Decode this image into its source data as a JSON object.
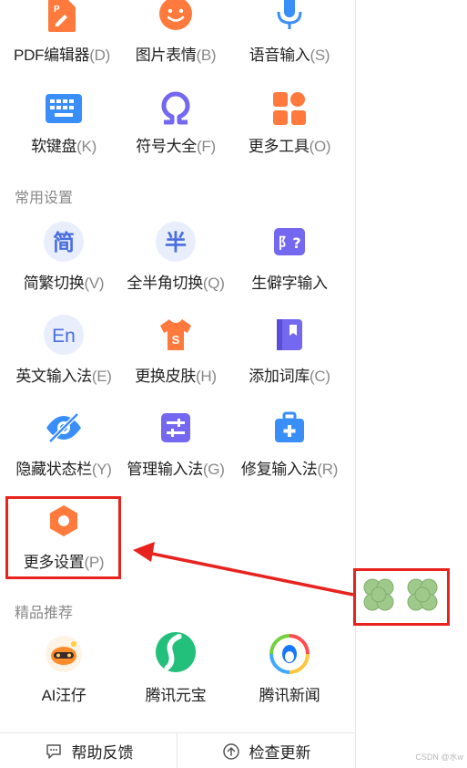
{
  "rows": [
    [
      {
        "name": "pdf-editor-item",
        "icon": "pdf-icon",
        "text": "PDF编辑器",
        "key": "(D)"
      },
      {
        "name": "emoji-item",
        "icon": "smiley-icon",
        "text": "图片表情",
        "key": "(B)"
      },
      {
        "name": "voice-input-item",
        "icon": "microphone-icon",
        "text": "语音输入",
        "key": "(S)"
      }
    ],
    [
      {
        "name": "soft-keyboard-item",
        "icon": "keyboard-icon",
        "text": "软键盘",
        "key": "(K)"
      },
      {
        "name": "symbols-item",
        "icon": "omega-icon",
        "text": "符号大全",
        "key": "(F)"
      },
      {
        "name": "more-tools-item",
        "icon": "grid-icon",
        "text": "更多工具",
        "key": "(O)"
      }
    ]
  ],
  "section_common": "常用设置",
  "settings_rows": [
    [
      {
        "name": "simplified-traditional-item",
        "icon": "jian-icon",
        "glyph": "简",
        "text": "简繁切换",
        "key": "(V)"
      },
      {
        "name": "full-half-width-item",
        "icon": "ban-icon",
        "glyph": "半",
        "text": "全半角切换",
        "key": "(Q)"
      },
      {
        "name": "rare-char-input-item",
        "icon": "rare-char-icon",
        "glyph": "阝?",
        "text": "生僻字输入",
        "key": ""
      }
    ],
    [
      {
        "name": "english-input-item",
        "icon": "en-icon",
        "glyph": "En",
        "text": "英文输入法",
        "key": "(E)"
      },
      {
        "name": "change-skin-item",
        "icon": "tshirt-icon",
        "glyph": "S",
        "text": "更换皮肤",
        "key": "(H)"
      },
      {
        "name": "add-dictionary-item",
        "icon": "book-icon",
        "glyph": "",
        "text": "添加词库",
        "key": "(C)"
      }
    ],
    [
      {
        "name": "hide-statusbar-item",
        "icon": "eye-off-icon",
        "glyph": "",
        "text": "隐藏状态栏",
        "key": "(Y)"
      },
      {
        "name": "manage-ime-item",
        "icon": "sliders-icon",
        "glyph": "",
        "text": "管理输入法",
        "key": "(G)"
      },
      {
        "name": "repair-ime-item",
        "icon": "toolbox-icon",
        "glyph": "",
        "text": "修复输入法",
        "key": "(R)"
      }
    ],
    [
      {
        "name": "more-settings-item",
        "icon": "hexagon-settings-icon",
        "glyph": "",
        "text": "更多设置",
        "key": "(P)"
      }
    ]
  ],
  "section_featured": "精品推荐",
  "featured": [
    {
      "name": "ai-wangzai-item",
      "icon": "ai-wangzai-icon",
      "text": "AI汪仔"
    },
    {
      "name": "tencent-yuanbao-item",
      "icon": "yuanbao-icon",
      "text": "腾讯元宝"
    },
    {
      "name": "tencent-news-item",
      "icon": "news-icon",
      "text": "腾讯新闻"
    }
  ],
  "footer": {
    "help": "帮助反馈",
    "update": "检查更新"
  },
  "watermark": "CSDN @水w",
  "colors": {
    "accent_orange": "#ff7a3c",
    "accent_blue": "#3a8ef7",
    "accent_purple": "#7467f0",
    "red_annotation": "#e8231f"
  }
}
